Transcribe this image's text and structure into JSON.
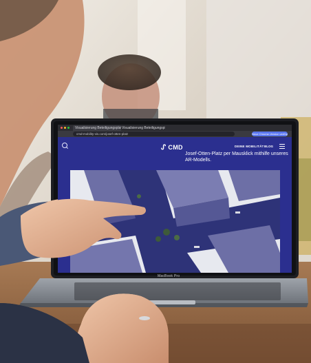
{
  "browser": {
    "tabs": [
      "Visualisierung Beteiligungsplattform",
      "Visualisierung Beteiligungsplattform"
    ],
    "url": "cmd-mobility-vis.com/josef-otten-platz",
    "update_button": "Neue Chrome-Version verfügbar"
  },
  "site": {
    "logo": "CMD",
    "nav": [
      "DEINE MOBILITÄT",
      "BLOG"
    ],
    "headline": "Josef-Otten-Platz per Mausklick mithilfe unseres AR-Modells."
  },
  "laptop": {
    "brand": "MacBook Pro"
  },
  "colors": {
    "site_background": "#2b2f8f",
    "buildings": "#6d6fa6",
    "streets": "#2e3378"
  }
}
